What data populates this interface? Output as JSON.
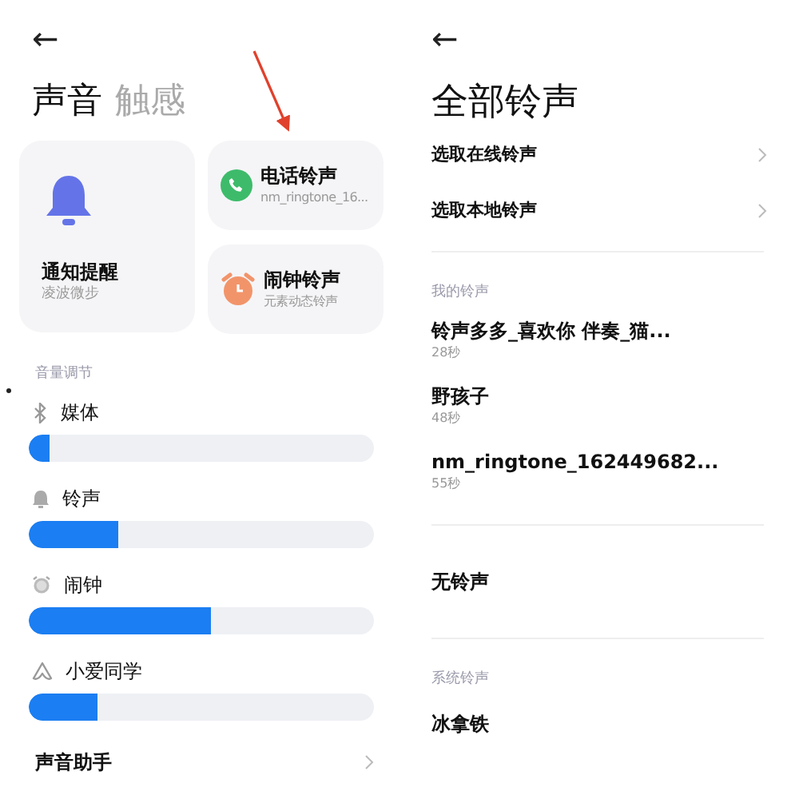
{
  "sound_screen": {
    "back": "←",
    "title": "声音",
    "other_tab": "触感",
    "cards": [
      {
        "kind": "big",
        "title": "通知提醒",
        "subtitle": "凌波微步"
      },
      {
        "kind": "phone",
        "title": "电话铃声",
        "subtitle": "nm_ringtone_16..."
      },
      {
        "kind": "alarm",
        "title": "闹钟铃声",
        "subtitle": "元素动态铃声"
      }
    ],
    "section": "音量调节",
    "volumes": [
      {
        "kind": "bluetooth",
        "label": "媒体",
        "level": 0.06
      },
      {
        "kind": "bell",
        "label": "铃声",
        "level": 0.26
      },
      {
        "kind": "alarm",
        "label": "闹钟",
        "level": 0.53
      },
      {
        "kind": "assistant",
        "label": "小爱同学",
        "level": 0.2
      }
    ],
    "assistant_row": {
      "title": "声音助手"
    }
  },
  "ringtones_screen": {
    "back": "←",
    "title": "全部铃声",
    "pickers": [
      "选取在线铃声",
      "选取本地铃声"
    ],
    "my_section": "我的铃声",
    "my_ringtones": [
      {
        "name": "铃声多多_喜欢你 伴奏_猫...",
        "duration": "28秒"
      },
      {
        "name": "野孩子",
        "duration": "48秒"
      },
      {
        "name": "nm_ringtone_162449682...",
        "duration": "55秒"
      }
    ],
    "none_option": "无铃声",
    "system_section": "系统铃声",
    "system_ringtones": [
      {
        "name": "冰拿铁"
      }
    ]
  }
}
